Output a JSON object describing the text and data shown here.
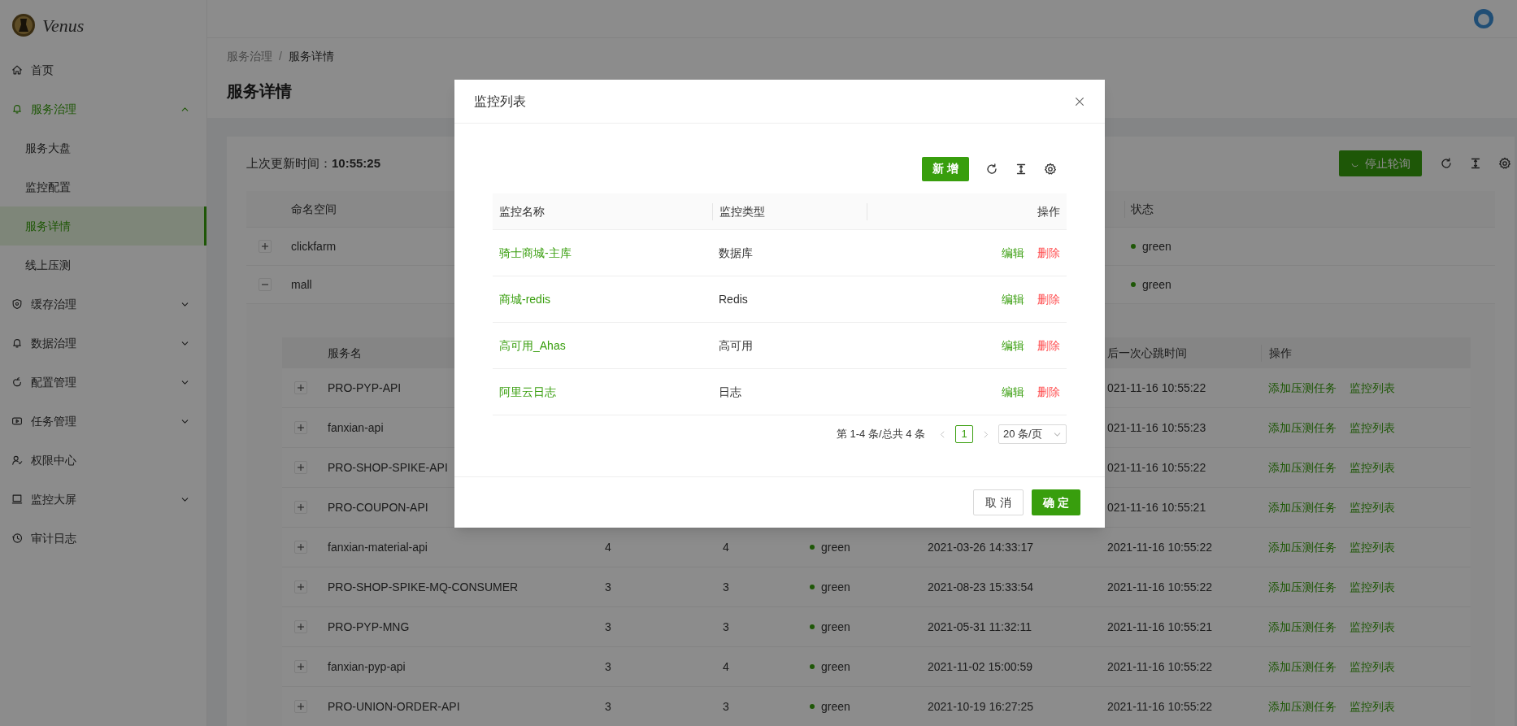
{
  "app": {
    "logo_text": "Venus"
  },
  "sidebar": {
    "items": [
      {
        "label": "首页",
        "kind": "item",
        "selected": false
      },
      {
        "label": "服务治理",
        "kind": "submenu",
        "expanded": true,
        "selected": false,
        "children": [
          {
            "label": "服务大盘",
            "selected": false
          },
          {
            "label": "监控配置",
            "selected": false
          },
          {
            "label": "服务详情",
            "selected": true
          },
          {
            "label": "线上压测",
            "selected": false
          }
        ]
      },
      {
        "label": "缓存治理",
        "kind": "submenu",
        "expanded": false,
        "selected": false
      },
      {
        "label": "数据治理",
        "kind": "submenu",
        "expanded": false,
        "selected": false
      },
      {
        "label": "配置管理",
        "kind": "submenu",
        "expanded": false,
        "selected": false
      },
      {
        "label": "任务管理",
        "kind": "submenu",
        "expanded": false,
        "selected": false
      },
      {
        "label": "权限中心",
        "kind": "item",
        "selected": false
      },
      {
        "label": "监控大屏",
        "kind": "submenu",
        "expanded": false,
        "selected": false
      },
      {
        "label": "审计日志",
        "kind": "item",
        "selected": false
      }
    ]
  },
  "breadcrumb": {
    "items": [
      "服务治理",
      "服务详情"
    ],
    "separator": "/"
  },
  "page_title": "服务详情",
  "card": {
    "last_update": "上次更新时间：**10:55:25**",
    "poll_button": "停止轮询"
  },
  "namespace_table": {
    "columns": {
      "name": "命名空间",
      "status": "状态"
    },
    "rows": [
      {
        "name": "clickfarm",
        "expanded": false,
        "status": "green"
      },
      {
        "name": "mall",
        "expanded": true,
        "status": "green"
      }
    ]
  },
  "service_table": {
    "columns": {
      "name": "服务名",
      "heartbeat": "后一次心跳时间",
      "actions": "操作"
    },
    "rows": [
      {
        "name": "PRO-PYP-API",
        "expanded": false,
        "heartbeat": "021-11-16 10:55:22",
        "actions": [
          "添加压测任务",
          "监控列表"
        ]
      },
      {
        "name": "fanxian-api",
        "expanded": false,
        "heartbeat": "021-11-16 10:55:23",
        "actions": [
          "添加压测任务",
          "监控列表"
        ]
      },
      {
        "name": "PRO-SHOP-SPIKE-API",
        "expanded": false,
        "heartbeat": "021-11-16 10:55:22",
        "actions": [
          "添加压测任务",
          "监控列表"
        ]
      },
      {
        "name": "PRO-COUPON-API",
        "expanded": false,
        "heartbeat": "021-11-16 10:55:21",
        "actions": [
          "添加压测任务",
          "监控列表"
        ]
      },
      {
        "name": "fanxian-material-api",
        "expanded": false,
        "column_2": "4",
        "column_3": "4",
        "status": "green",
        "column_5": "2021-03-26 14:33:17",
        "heartbeat": "2021-11-16 10:55:22",
        "actions": [
          "添加压测任务",
          "监控列表"
        ]
      },
      {
        "name": "PRO-SHOP-SPIKE-MQ-CONSUMER",
        "expanded": false,
        "column_2": "3",
        "column_3": "3",
        "status": "green",
        "column_5": "2021-08-23 15:33:54",
        "heartbeat": "2021-11-16 10:55:22",
        "actions": [
          "添加压测任务",
          "监控列表"
        ]
      },
      {
        "name": "PRO-PYP-MNG",
        "expanded": false,
        "column_2": "3",
        "column_3": "3",
        "status": "green",
        "column_5": "2021-05-31 11:32:11",
        "heartbeat": "2021-11-16 10:55:21",
        "actions": [
          "添加压测任务",
          "监控列表"
        ]
      },
      {
        "name": "fanxian-pyp-api",
        "expanded": false,
        "column_2": "3",
        "column_3": "4",
        "status": "green",
        "column_5": "2021-11-02 15:00:59",
        "heartbeat": "2021-11-16 10:55:22",
        "actions": [
          "添加压测任务",
          "监控列表"
        ]
      },
      {
        "name": "PRO-UNION-ORDER-API",
        "expanded": false,
        "column_2": "3",
        "column_3": "3",
        "status": "green",
        "column_5": "2021-10-19 16:27:25",
        "heartbeat": "2021-11-16 10:55:22",
        "actions": [
          "添加压测任务",
          "监控列表"
        ]
      }
    ]
  },
  "modal": {
    "title": "监控列表",
    "add_button": "新 增",
    "table": {
      "columns": [
        "监控名称",
        "监控类型",
        "操作"
      ],
      "rows": [
        {
          "name": "骑士商城-主库",
          "type": "数据库",
          "actions": [
            {
              "label": "编辑",
              "kind": "edit"
            },
            {
              "label": "删除",
              "kind": "delete"
            }
          ]
        },
        {
          "name": "商城-redis",
          "type": "Redis",
          "actions": [
            {
              "label": "编辑",
              "kind": "edit"
            },
            {
              "label": "删除",
              "kind": "delete"
            }
          ]
        },
        {
          "name": "高可用_Ahas",
          "type": "高可用",
          "actions": [
            {
              "label": "编辑",
              "kind": "edit"
            },
            {
              "label": "删除",
              "kind": "delete"
            }
          ]
        },
        {
          "name": "阿里云日志",
          "type": "日志",
          "actions": [
            {
              "label": "编辑",
              "kind": "edit"
            },
            {
              "label": "删除",
              "kind": "delete"
            }
          ]
        }
      ]
    },
    "pagination": {
      "summary": "第 1-4 条/总共 4 条",
      "pages": [
        {
          "label": "1",
          "selected": true
        }
      ],
      "page_size": "20 条/页"
    },
    "footer": {
      "cancel": "取 消",
      "ok": "确 定"
    }
  }
}
